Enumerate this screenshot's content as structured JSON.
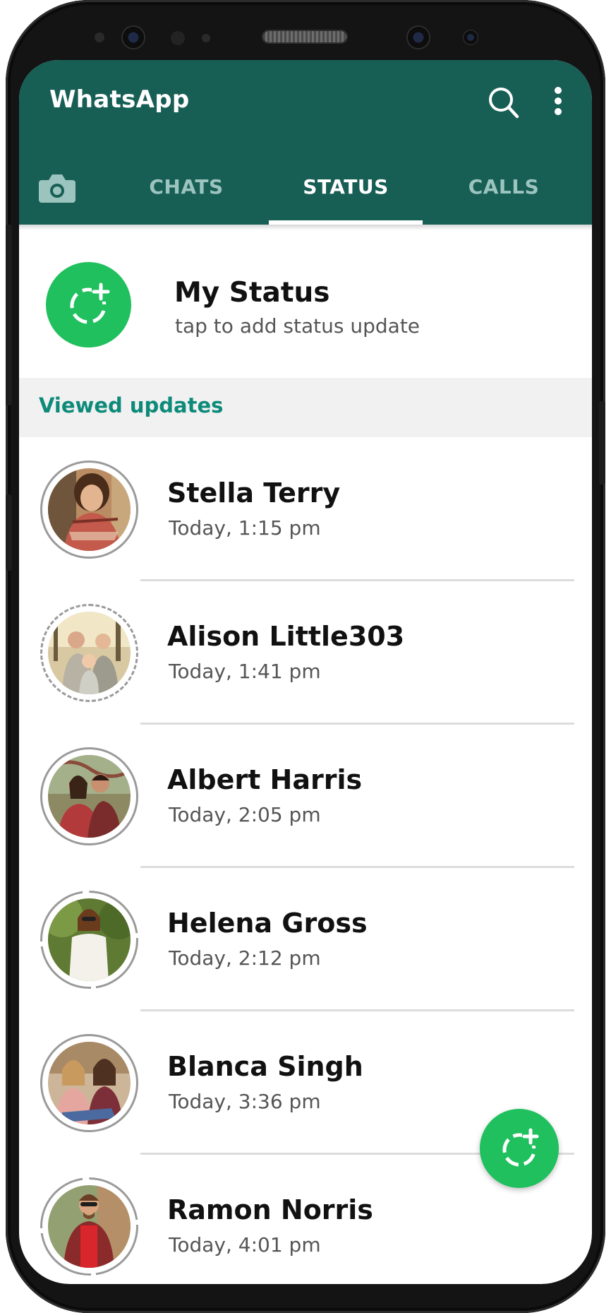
{
  "app": {
    "title": "WhatsApp"
  },
  "header": {
    "search_icon": "search-icon",
    "menu_icon": "more-vertical-icon"
  },
  "tabs": {
    "camera_icon": "camera-icon",
    "items": [
      {
        "label": "CHATS",
        "active": false
      },
      {
        "label": "STATUS",
        "active": true
      },
      {
        "label": "CALLS",
        "active": false
      }
    ]
  },
  "my_status": {
    "name": "My Status",
    "subtitle": "tap to add status update",
    "icon": "add-status-icon"
  },
  "viewed_updates": {
    "heading": "Viewed updates",
    "items": [
      {
        "name": "Stella Terry",
        "time": "Today, 1:15 pm",
        "ring": "solid"
      },
      {
        "name": "Alison Little303",
        "time": "Today, 1:41 pm",
        "ring": "dashed"
      },
      {
        "name": "Albert Harris",
        "time": "Today, 2:05 pm",
        "ring": "solid"
      },
      {
        "name": "Helena Gross",
        "time": "Today, 2:12 pm",
        "ring": "segmented"
      },
      {
        "name": "Blanca Singh",
        "time": "Today, 3:36 pm",
        "ring": "solid"
      },
      {
        "name": "Ramon Norris",
        "time": "Today, 4:01 pm",
        "ring": "segmented"
      }
    ]
  },
  "fab": {
    "icon": "add-status-icon"
  },
  "colors": {
    "header": "#175e55",
    "accent_green": "#1fc05d",
    "section_text": "#0d8a79",
    "inactive_tab": "#9cc4be"
  }
}
